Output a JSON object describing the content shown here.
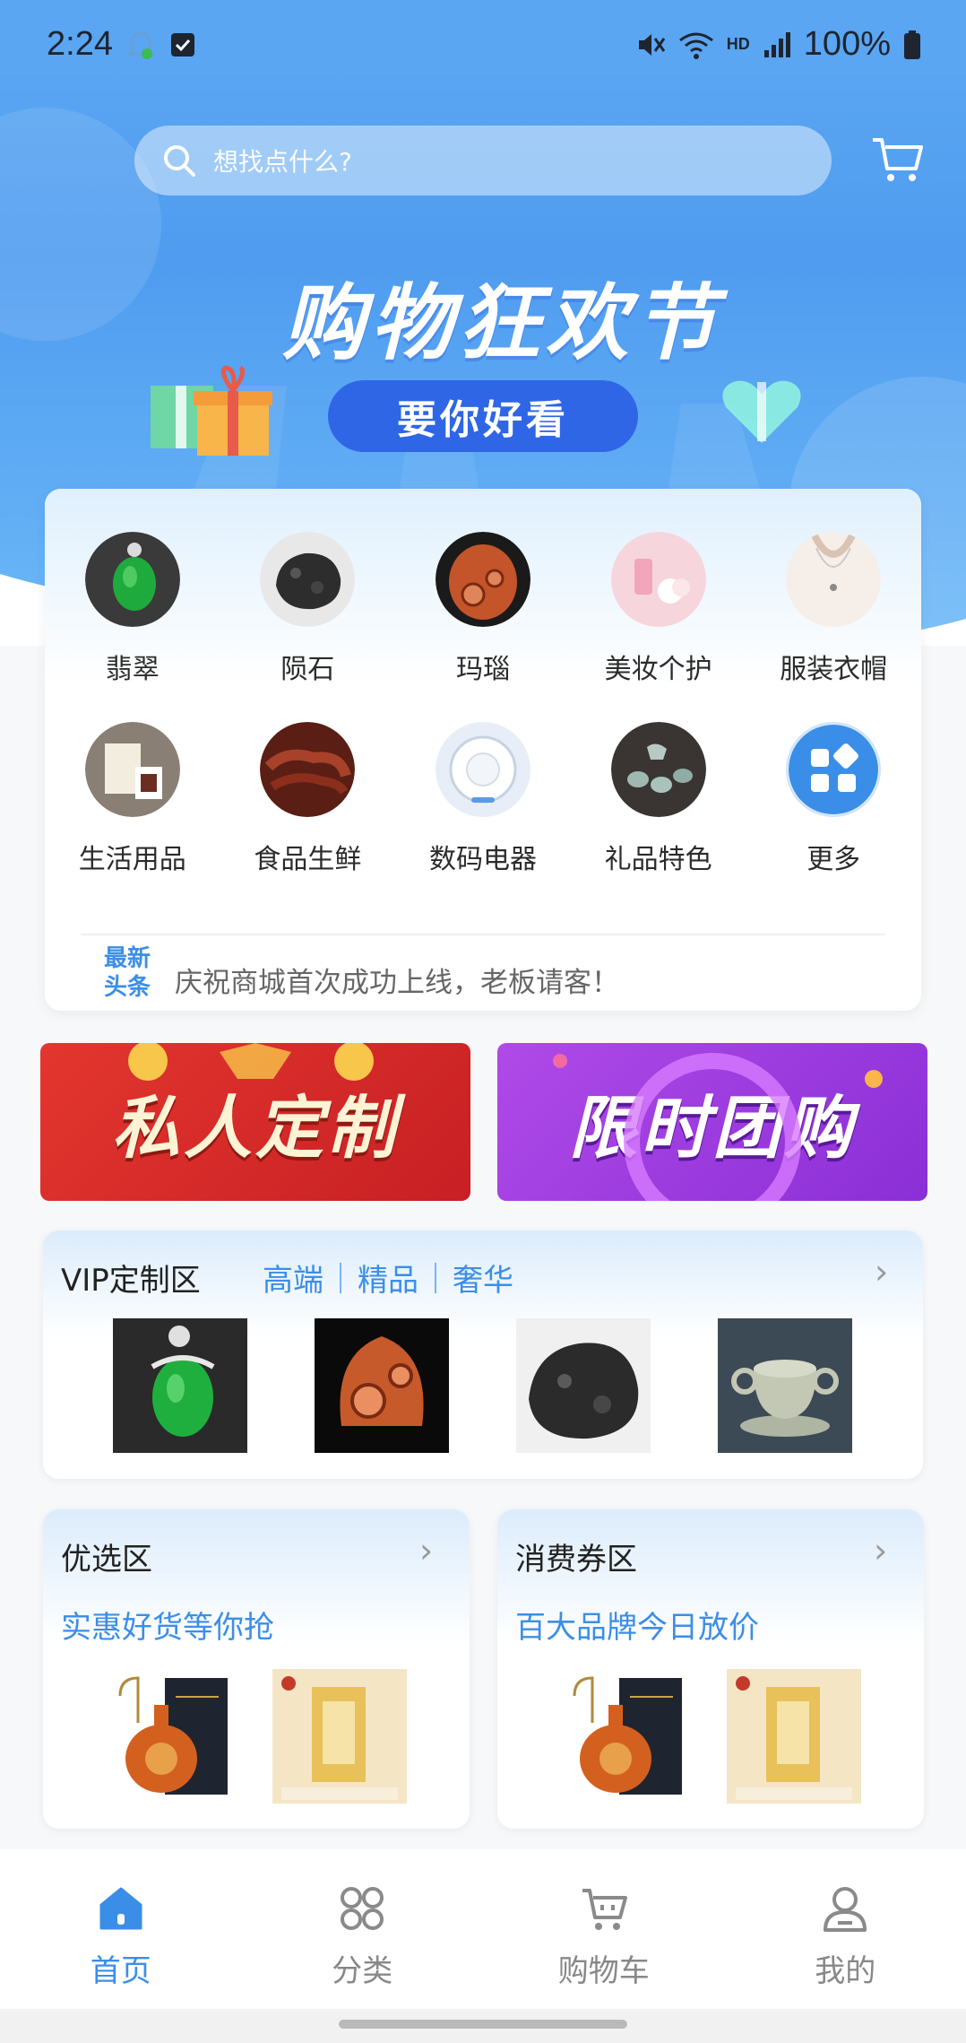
{
  "status_bar": {
    "time": "2:24",
    "battery": "100%",
    "network": "HD"
  },
  "search": {
    "placeholder": "想找点什么?"
  },
  "banner": {
    "title": "购物狂欢节",
    "pill_text": "要你好看"
  },
  "categories": [
    {
      "label": "翡翠",
      "icon": "jade-pendant-icon"
    },
    {
      "label": "陨石",
      "icon": "meteorite-icon"
    },
    {
      "label": "玛瑙",
      "icon": "agate-icon"
    },
    {
      "label": "美妆个护",
      "icon": "cosmetics-icon"
    },
    {
      "label": "服装衣帽",
      "icon": "necklace-model-icon"
    },
    {
      "label": "生活用品",
      "icon": "daily-goods-icon"
    },
    {
      "label": "食品生鲜",
      "icon": "food-icon"
    },
    {
      "label": "数码电器",
      "icon": "robot-vacuum-icon"
    },
    {
      "label": "礼品特色",
      "icon": "tea-set-icon"
    },
    {
      "label": "更多",
      "icon": "grid-more-icon"
    }
  ],
  "news": {
    "tag_line1": "最新",
    "tag_line2": "头条",
    "text": "庆祝商城首次成功上线，老板请客！"
  },
  "promos": [
    {
      "text": "私人定制",
      "color": "#d8312b"
    },
    {
      "text": "限时团购",
      "color": "#a23fe0"
    }
  ],
  "vip": {
    "title": "VIP定制区",
    "tags": [
      "高端",
      "精品",
      "奢华"
    ]
  },
  "sections": [
    {
      "title": "优选区",
      "subtitle": "实惠好货等你抢"
    },
    {
      "title": "消费券区",
      "subtitle": "百大品牌今日放价"
    }
  ],
  "nav": [
    {
      "label": "首页",
      "icon": "home-icon",
      "active": true
    },
    {
      "label": "分类",
      "icon": "category-icon",
      "active": false
    },
    {
      "label": "购物车",
      "icon": "cart-icon",
      "active": false
    },
    {
      "label": "我的",
      "icon": "user-icon",
      "active": false
    }
  ],
  "colors": {
    "accent": "#3b8ee8",
    "hero_blue": "#4f9cf0"
  }
}
